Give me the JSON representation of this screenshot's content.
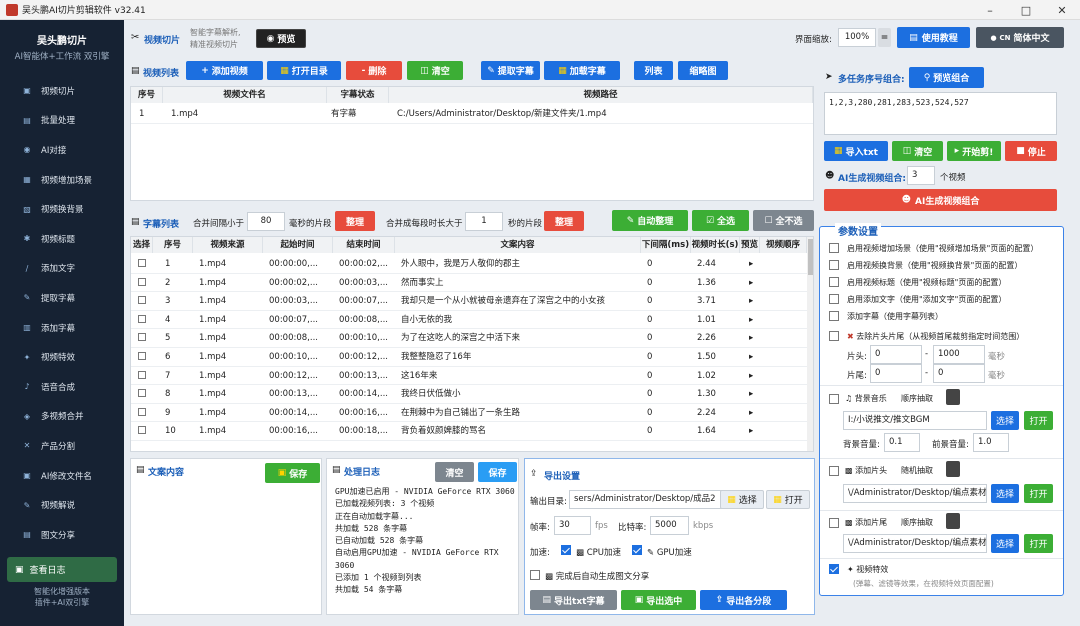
{
  "window": {
    "title": "吴头鹏AI切片剪辑软件 v32.41"
  },
  "sidebar": {
    "brand_title": "吴头鹏切片",
    "brand_subtitle": "AI智能体+工作流 双引擎",
    "items": [
      {
        "icon": "video-icon",
        "label": "视频切片"
      },
      {
        "icon": "batch-icon",
        "label": "批量处理"
      },
      {
        "icon": "ai-icon",
        "label": "AI对接"
      },
      {
        "icon": "scene-icon",
        "label": "视频增加场景"
      },
      {
        "icon": "bg-icon",
        "label": "视频换背景"
      },
      {
        "icon": "title-icon",
        "label": "视频标题"
      },
      {
        "icon": "text-icon",
        "label": "添加文字"
      },
      {
        "icon": "extract-icon",
        "label": "提取字幕"
      },
      {
        "icon": "subtitle-icon",
        "label": "添加字幕"
      },
      {
        "icon": "effect-icon",
        "label": "视频特效"
      },
      {
        "icon": "voice-icon",
        "label": "语音合成"
      },
      {
        "icon": "merge-icon",
        "label": "多视频合并"
      },
      {
        "icon": "split-icon",
        "label": "产品分割"
      },
      {
        "icon": "rename-icon",
        "label": "AI修改文件名"
      },
      {
        "icon": "explain-icon",
        "label": "视频解说"
      },
      {
        "icon": "share-icon",
        "label": "图文分享"
      }
    ],
    "log_button": "查看日志",
    "footer_line1": "智能化增强版本",
    "footer_line2": "插件+AI双引擎"
  },
  "topbar": {
    "section": "视频切片",
    "desc_line1": "智能字幕解析,",
    "desc_line2": "精准视频切片",
    "preview": "预览",
    "zoom_label": "界面缩放:",
    "zoom_value": "100%",
    "zoom_toggle": "=",
    "tutorial": "使用教程",
    "language": "简体中文",
    "language_prefix": "CN"
  },
  "video_list": {
    "title": "视频列表",
    "buttons": {
      "add": "添加视频",
      "open_dir": "打开目录",
      "delete": "删除",
      "clear": "清空",
      "extract": "提取字幕",
      "load": "加载字幕",
      "list": "列表",
      "thumb": "缩略图"
    },
    "headers": [
      "序号",
      "视频文件名",
      "字幕状态",
      "视频路径"
    ],
    "rows": [
      {
        "no": "1",
        "name": "1.mp4",
        "status": "有字幕",
        "path": "C:/Users/Administrator/Desktop/新建文件夹/1.mp4"
      }
    ]
  },
  "subtitle_list": {
    "title": "字幕列表",
    "merge_gap_label": "合并间隔小于",
    "merge_gap_value": "80",
    "merge_gap_unit": "毫秒的片段",
    "tidy1": "整理",
    "merge_dur_label": "合并成每段时长大于",
    "merge_dur_value": "1",
    "merge_dur_unit": "秒的片段",
    "tidy2": "整理",
    "auto_tidy": "自动整理",
    "select_all": "全选",
    "select_none": "全不选",
    "headers": [
      "选择",
      "序号",
      "视频来源",
      "起始时间",
      "结束时间",
      "文案内容",
      "下间隔(ms)",
      "视频时长(s)",
      "预览",
      "视频顺序"
    ],
    "rows": [
      {
        "no": "1",
        "src": "1.mp4",
        "start": "00:00:00,...",
        "end": "00:00:02,...",
        "text": "外人眼中，我是万人敬仰的郡主",
        "gap": "0",
        "dur": "2.44"
      },
      {
        "no": "2",
        "src": "1.mp4",
        "start": "00:00:02,...",
        "end": "00:00:03,...",
        "text": "然而事实上",
        "gap": "0",
        "dur": "1.36"
      },
      {
        "no": "3",
        "src": "1.mp4",
        "start": "00:00:03,...",
        "end": "00:00:07,...",
        "text": "我却只是一个从小就被母亲遗弃在了深宫之中的小女孩",
        "gap": "0",
        "dur": "3.71"
      },
      {
        "no": "4",
        "src": "1.mp4",
        "start": "00:00:07,...",
        "end": "00:00:08,...",
        "text": "自小无依的我",
        "gap": "0",
        "dur": "1.01"
      },
      {
        "no": "5",
        "src": "1.mp4",
        "start": "00:00:08,...",
        "end": "00:00:10,...",
        "text": "为了在这吃人的深宫之中活下来",
        "gap": "0",
        "dur": "2.26"
      },
      {
        "no": "6",
        "src": "1.mp4",
        "start": "00:00:10,...",
        "end": "00:00:12,...",
        "text": "我整整隐忍了16年",
        "gap": "0",
        "dur": "1.50"
      },
      {
        "no": "7",
        "src": "1.mp4",
        "start": "00:00:12,...",
        "end": "00:00:13,...",
        "text": "这16年来",
        "gap": "0",
        "dur": "1.02"
      },
      {
        "no": "8",
        "src": "1.mp4",
        "start": "00:00:13,...",
        "end": "00:00:14,...",
        "text": "我终日伏低做小",
        "gap": "0",
        "dur": "1.30"
      },
      {
        "no": "9",
        "src": "1.mp4",
        "start": "00:00:14,...",
        "end": "00:00:16,...",
        "text": "在荆棘中为自己铺出了一条生路",
        "gap": "0",
        "dur": "2.24"
      },
      {
        "no": "10",
        "src": "1.mp4",
        "start": "00:00:16,...",
        "end": "00:00:18,...",
        "text": "背负着奴颜婢膝的骂名",
        "gap": "0",
        "dur": "1.64"
      }
    ],
    "preview_glyph": "▸"
  },
  "copy_panel": {
    "title": "文案内容",
    "save": "保存"
  },
  "log_panel": {
    "title": "处理日志",
    "clear": "清空",
    "save": "保存",
    "lines": [
      "GPU加速已启用 - NVIDIA GeForce RTX 3060",
      "已加载视频列表: 3 个视频",
      "正在自动加载字幕...",
      "共加载 528 条字幕",
      "已自动加载 528 条字幕",
      "自动启用GPU加速 - NVIDIA GeForce RTX",
      "3060",
      "已添加 1 个视频到列表",
      "共加载 54 条字幕"
    ]
  },
  "export": {
    "title": "导出设置",
    "dir_label": "输出目录:",
    "dir_value": "sers/Administrator/Desktop/成品2",
    "choose": "选择",
    "open": "打开",
    "fps_label": "帧率:",
    "fps_value": "30",
    "fps_unit": "fps",
    "bitrate_label": "比特率:",
    "bitrate_value": "5000",
    "bitrate_unit": "kbps",
    "accel_label": "加速:",
    "cpu": "CPU加速",
    "gpu": "GPU加速",
    "auto_share": "完成后自动生成图文分享",
    "export_txt": "导出txt字幕",
    "export_selected": "导出选中",
    "export_each": "导出各分段"
  },
  "right": {
    "multi_title": "多任务序号组合:",
    "preview_combo": "预览组合",
    "combo_value": "1,2,3,280,281,283,523,524,527",
    "import_txt": "导入txt",
    "clear": "清空",
    "start": "开始剪!",
    "stop": "停止",
    "ai_count_label": "AI生成视频组合:",
    "ai_count_value": "3",
    "ai_count_unit": "个视频",
    "ai_generate": "AI生成视频组合",
    "params_title": "参数设置",
    "opt1": "启用视频增加场景（使用\"视频增加场景\"页面的配置）",
    "opt2": "启用视频换背景（使用\"视频换背景\"页面的配置）",
    "opt3": "启用视频标题（使用\"视频标题\"页面的配置）",
    "opt4": "启用添加文字（使用\"添加文字\"页面的配置）",
    "opt5": "添加字幕（使用字幕列表）",
    "trim_label": "去除片头片尾（从视频首尾裁剪指定时间范围）",
    "head_label": "片头:",
    "head_from": "0",
    "head_to": "1000",
    "tail_label": "片尾:",
    "tail_from": "0",
    "tail_to": "0",
    "ms": "毫秒",
    "dash": "-",
    "bgm_label": "背景音乐",
    "bgm_mode": "顺序抽取",
    "bgm_path": "I:/小说推文/推文BGM",
    "choose": "选择",
    "open": "打开",
    "bg_vol_label": "背景音量:",
    "bg_vol": "0.1",
    "fg_vol_label": "前景音量:",
    "fg_vol": "1.0",
    "head_clip_label": "添加片头",
    "head_clip_mode": "随机抽取",
    "head_clip_path": "\\/Administrator/Desktop/编点素材",
    "tail_clip_label": "添加片尾",
    "tail_clip_mode": "顺序抽取",
    "tail_clip_path": "\\/Administrator/Desktop/编点素材",
    "effects_label": "视频特效",
    "effects_desc": "(弹幕、滤镜等效果，在视频特效页面配置)"
  }
}
